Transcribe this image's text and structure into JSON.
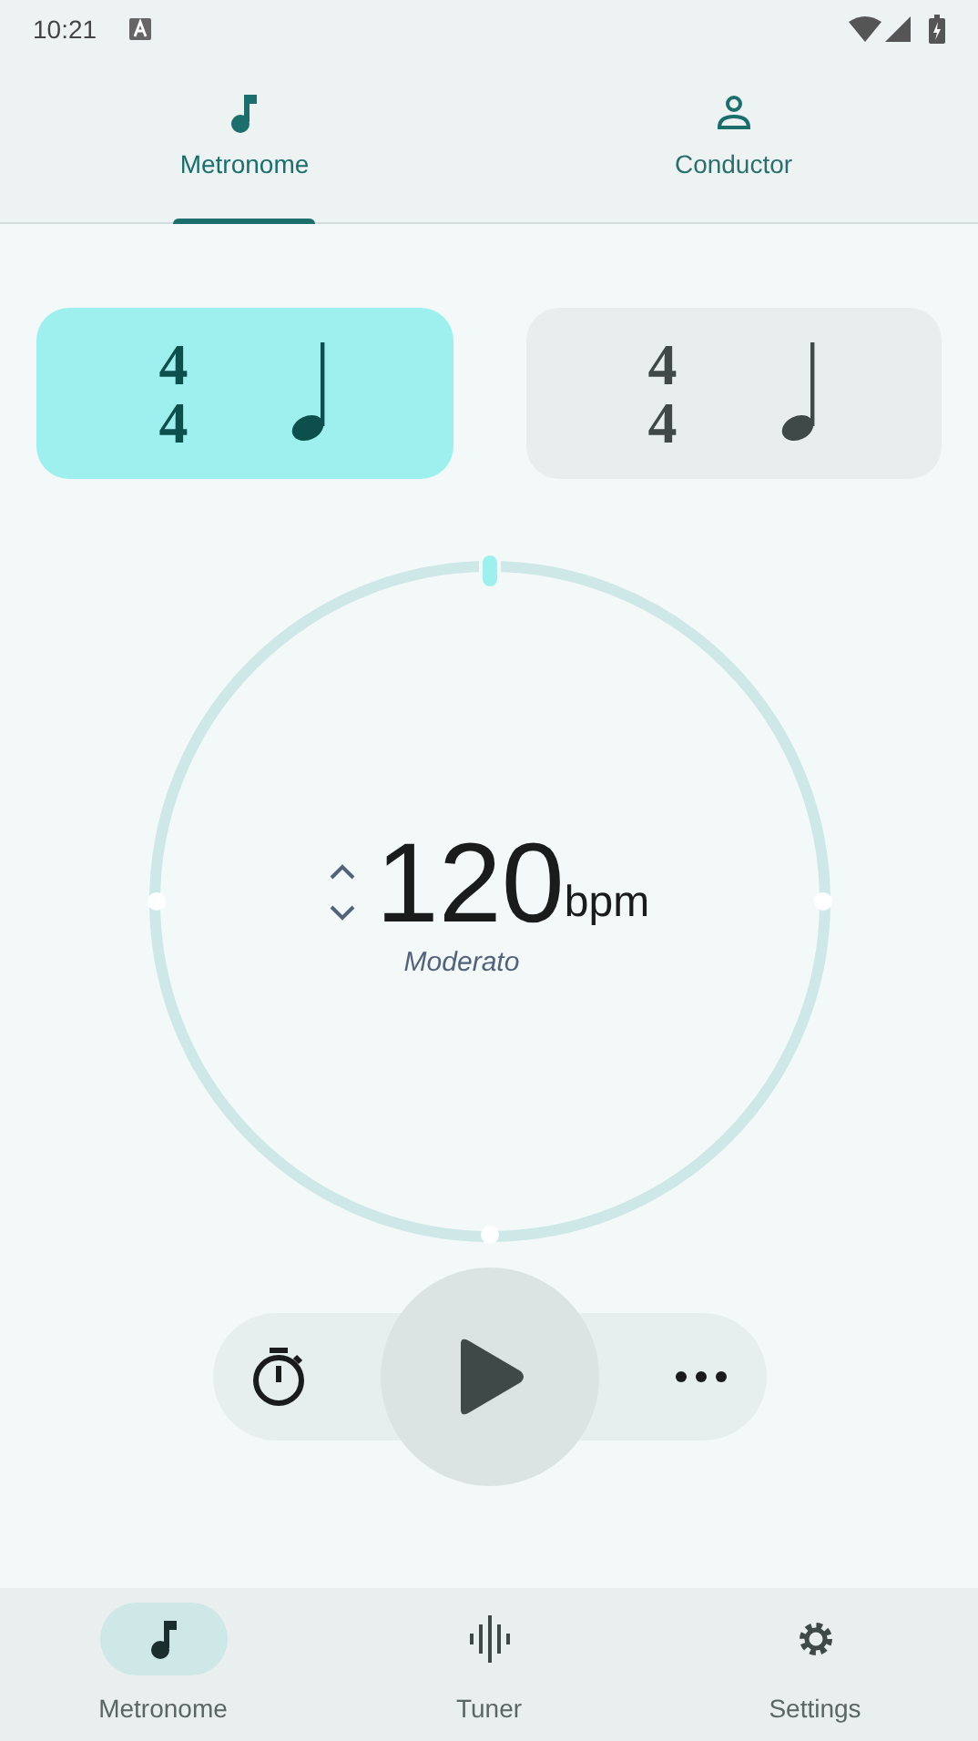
{
  "status_bar": {
    "time": "10:21"
  },
  "tabs": [
    {
      "label": "Metronome",
      "selected": true,
      "kind": "note"
    },
    {
      "label": "Conductor",
      "selected": false,
      "kind": "person"
    }
  ],
  "meter_cards": [
    {
      "numerator": "4",
      "denominator": "4",
      "selected": true
    },
    {
      "numerator": "4",
      "denominator": "4",
      "selected": false
    }
  ],
  "tempo": {
    "value": "120",
    "unit": "bpm",
    "marking": "Moderato"
  },
  "bottom_nav": [
    {
      "label": "Metronome",
      "selected": true,
      "kind": "note"
    },
    {
      "label": "Tuner",
      "selected": false,
      "kind": "wave"
    },
    {
      "label": "Settings",
      "selected": false,
      "kind": "gear"
    }
  ]
}
